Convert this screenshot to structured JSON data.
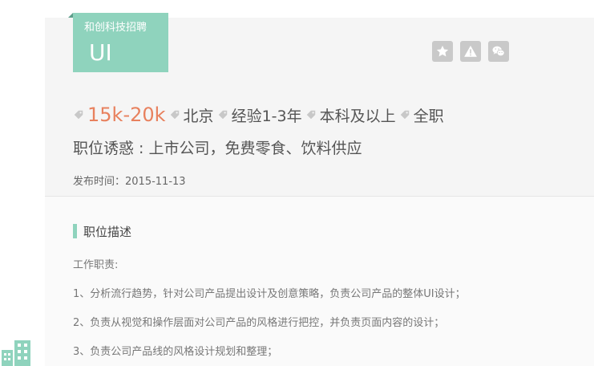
{
  "job": {
    "company_name": "和创科技招聘",
    "title": "UI",
    "salary": "15k-20k",
    "city": "北京",
    "experience": "经验1-3年",
    "education": "本科及以上",
    "job_type": "全职",
    "advantage": "职位诱惑 : 上市公司，免费零食、饮料供应",
    "publish_time": "发布时间：2015-11-13"
  },
  "actions": {
    "collect_icon": "star-icon",
    "report_icon": "warning-icon",
    "share_icon": "wechat-icon"
  },
  "description": {
    "section_title": "职位描述",
    "lines": [
      "工作职责:",
      "1、分析流行趋势，针对公司产品提出设计及创意策略，负责公司产品的整体UI设计；",
      "2、负责从视觉和操作层面对公司产品的风格进行把控，并负责页面内容的设计；",
      "3、负责公司产品线的风格设计规划和整理；"
    ]
  },
  "colors": {
    "accent": "#8fd3bd",
    "salary": "#e8815e",
    "icon_button": "#c9c9c9"
  }
}
